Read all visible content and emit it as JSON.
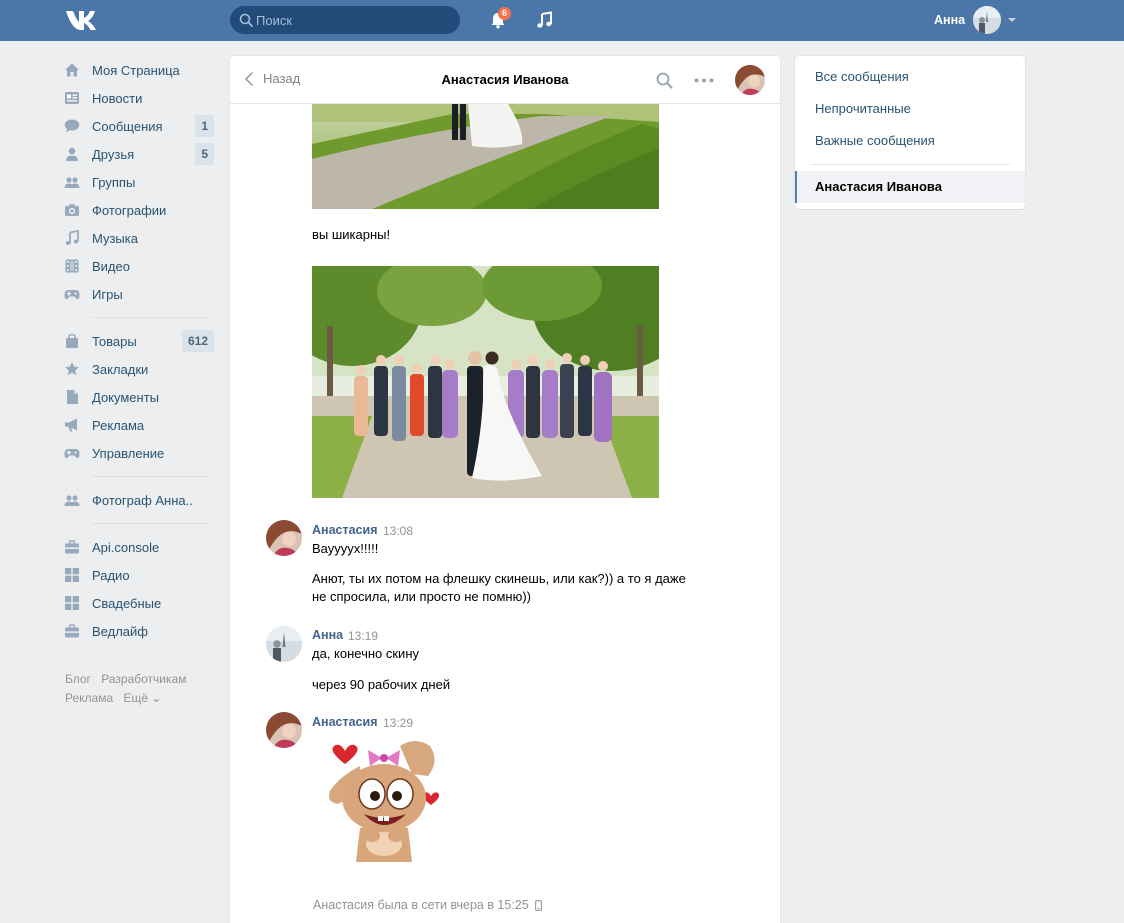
{
  "header": {
    "search_placeholder": "Поиск",
    "notifications_count": "6",
    "user_name": "Анна"
  },
  "left_menu": {
    "main": [
      {
        "label": "Моя Страница",
        "icon": "home-icon"
      },
      {
        "label": "Новости",
        "icon": "news-icon"
      },
      {
        "label": "Сообщения",
        "icon": "messages-icon",
        "count": "1"
      },
      {
        "label": "Друзья",
        "icon": "friends-icon",
        "count": "5"
      },
      {
        "label": "Группы",
        "icon": "groups-icon"
      },
      {
        "label": "Фотографии",
        "icon": "camera-icon"
      },
      {
        "label": "Музыка",
        "icon": "music-icon"
      },
      {
        "label": "Видео",
        "icon": "video-icon"
      },
      {
        "label": "Игры",
        "icon": "gamepad-icon"
      }
    ],
    "secondary": [
      {
        "label": "Товары",
        "icon": "bag-icon",
        "count": "612"
      },
      {
        "label": "Закладки",
        "icon": "star-icon"
      },
      {
        "label": "Документы",
        "icon": "document-icon"
      },
      {
        "label": "Реклама",
        "icon": "megaphone-icon"
      },
      {
        "label": "Управление",
        "icon": "gamepad-icon"
      }
    ],
    "groups": [
      {
        "label": "Фотограф Анна..",
        "icon": "groups-icon"
      }
    ],
    "apps": [
      {
        "label": "Api.console",
        "icon": "briefcase-icon"
      },
      {
        "label": "Радио",
        "icon": "apps-grid-icon"
      },
      {
        "label": "Свадебные",
        "icon": "apps-grid-icon"
      },
      {
        "label": "Ведлайф",
        "icon": "briefcase-icon"
      }
    ],
    "footer": {
      "blog": "Блог",
      "developers": "Разработчикам",
      "ads": "Реклама",
      "more": "Ещё ⌄"
    }
  },
  "chat": {
    "back_label": "Назад",
    "title": "Анастасия Иванова",
    "messages": {
      "m1_text": "вы шикарны!",
      "m2_author": "Анастасия",
      "m2_time": "13:08",
      "m2_line1": "Вауууух!!!!!",
      "m2_line2a": "Анют, ты их потом на флешку скинешь, или как?)) а то я даже",
      "m2_line2b": "не спросила, или просто не помню))",
      "m3_author": "Анна",
      "m3_time": "13:19",
      "m3_line1": "да, конечно скину",
      "m3_line2": "через 90 рабочих дней",
      "m4_author": "Анастасия",
      "m4_time": "13:29"
    },
    "status": "Анастасия была в сети вчера в 15:25"
  },
  "right_menu": {
    "all": "Все сообщения",
    "unread": "Непрочитанные",
    "important": "Важные сообщения",
    "conversation": "Анастасия Иванова"
  },
  "colors": {
    "header": "#4a76a8",
    "link": "#285473",
    "author": "#42648b",
    "badge": "#ff734c"
  }
}
